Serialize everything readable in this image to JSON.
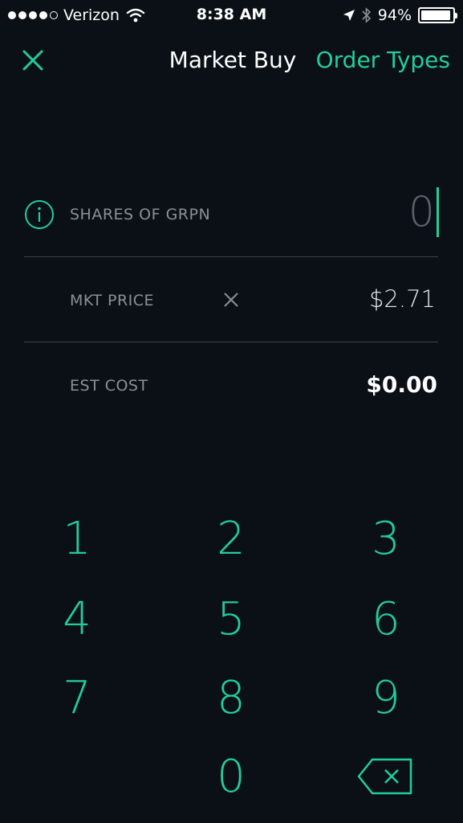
{
  "status_bar": {
    "carrier": "Verizon",
    "time": "8:38 AM",
    "battery": "94%",
    "battery_level": 0.94,
    "signal_bars_filled": 4,
    "signal_bars_total": 5
  },
  "nav": {
    "title": "Market Buy",
    "order_types_label": "Order Types",
    "close_icon": "close-icon"
  },
  "form": {
    "shares_label": "SHARES OF GRPN",
    "shares_value": "0",
    "mkt_price_label": "MKT PRICE",
    "mkt_price_value": "$2.71",
    "est_cost_label": "EST COST",
    "est_cost_value": "$0.00"
  },
  "keypad": {
    "keys": [
      "1",
      "2",
      "3",
      "4",
      "5",
      "6",
      "7",
      "8",
      "9",
      "0"
    ],
    "backspace_icon": "backspace-icon"
  },
  "colors": {
    "accent": "#21ce99",
    "background": "#0a1016",
    "label": "#8a9095",
    "divider": "#3a4248"
  }
}
